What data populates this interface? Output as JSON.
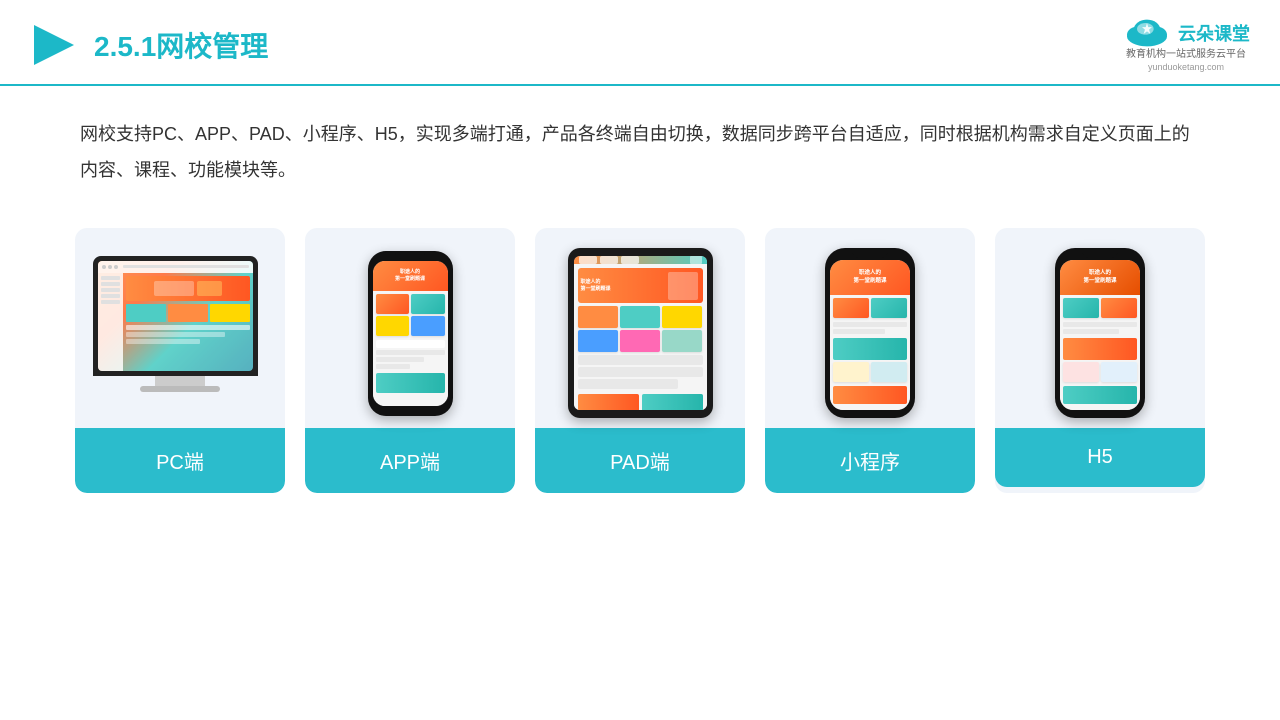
{
  "header": {
    "title_prefix": "2.5.1",
    "title_main": "网校管理",
    "logo_text": "云朵课堂",
    "logo_subtitle_line1": "教育机构一站",
    "logo_subtitle_line2": "式服务云平台",
    "logo_url": "yunduoketang.com"
  },
  "description": {
    "text": "网校支持PC、APP、PAD、小程序、H5，实现多端打通，产品各终端自由切换，数据同步跨平台自适应，同时根据机构需求自定义页面上的内容、课程、功能模块等。"
  },
  "cards": [
    {
      "id": "pc",
      "label": "PC端"
    },
    {
      "id": "app",
      "label": "APP端"
    },
    {
      "id": "pad",
      "label": "PAD端"
    },
    {
      "id": "miniprogram",
      "label": "小程序"
    },
    {
      "id": "h5",
      "label": "H5"
    }
  ],
  "accent_color": "#2bbccc"
}
